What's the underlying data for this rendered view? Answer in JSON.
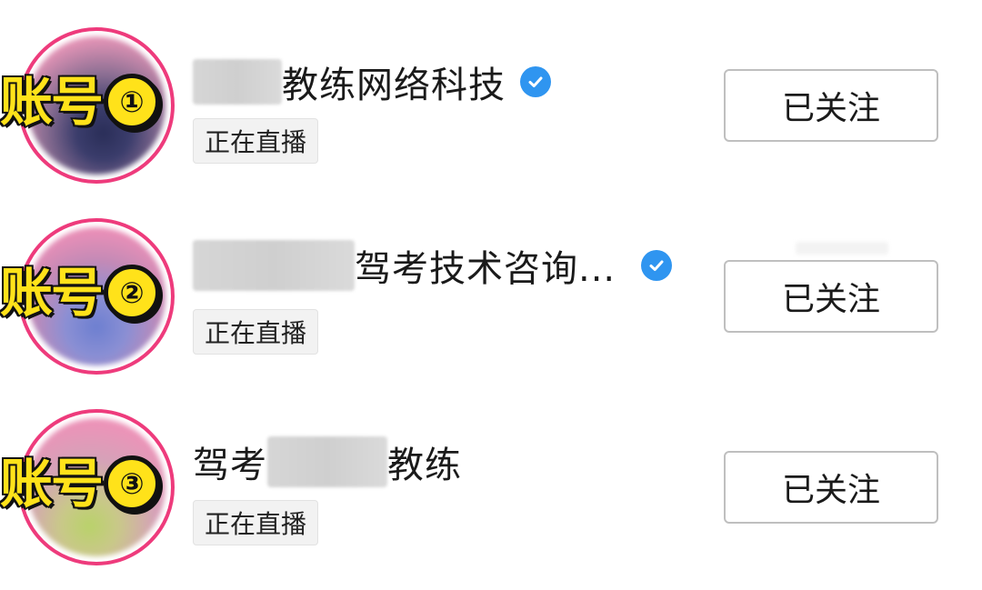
{
  "accounts": [
    {
      "tag": "账号",
      "number": "①",
      "name_suffix": "教练网络科技",
      "verified": true,
      "live_label": "正在直播",
      "follow_label": "已关注",
      "verified_icon": "verified-check-icon"
    },
    {
      "tag": "账号",
      "number": "②",
      "name_suffix": "驾考技术咨询...",
      "verified": true,
      "live_label": "正在直播",
      "follow_label": "已关注",
      "verified_icon": "verified-check-icon"
    },
    {
      "tag": "账号",
      "number": "③",
      "name_prefix": "驾考",
      "name_suffix": "教练",
      "verified": false,
      "live_label": "正在直播",
      "follow_label": "已关注"
    }
  ],
  "colors": {
    "ring": "#ee3b7c",
    "verified": "#2f95f0",
    "tag_fill": "#ffe21a",
    "tag_stroke": "#111111"
  }
}
